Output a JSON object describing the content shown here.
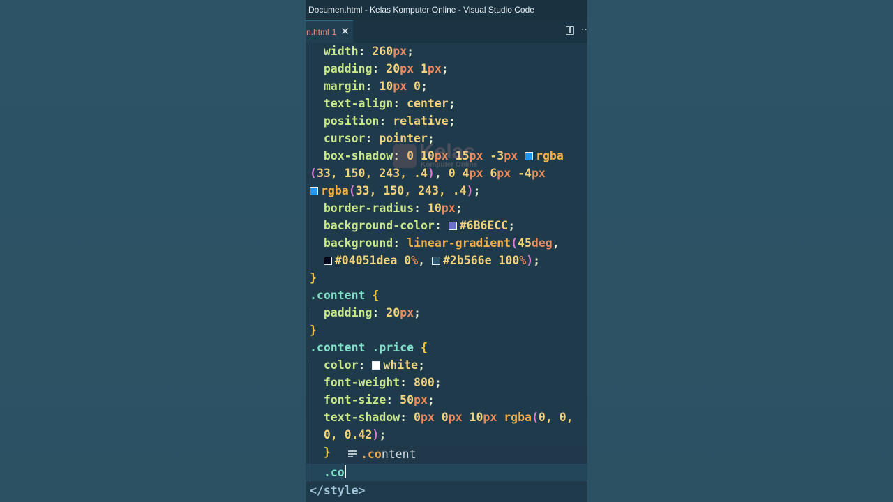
{
  "window": {
    "title": "Documen.html - Kelas Komputer Online - Visual Studio Code"
  },
  "tab": {
    "name": "n.html",
    "problems": "1",
    "close": "✕"
  },
  "toolbar": {
    "more": "···"
  },
  "watermark": {
    "title": "Kelas",
    "subtitle": "Komputer Online"
  },
  "colors": {
    "swatch_rgba": "#2196f3",
    "swatch_6b6ecc": "#6B6ECC",
    "swatch_04051d": "#04051d",
    "swatch_2b566e": "#2b566e",
    "swatch_white": "#ffffff"
  },
  "code": {
    "l1": {
      "prop": "width",
      "num": "260",
      "unit": "px"
    },
    "l2": {
      "prop": "padding",
      "n1": "20",
      "u1": "px",
      "n2": "1",
      "u2": "px"
    },
    "l3": {
      "prop": "margin",
      "n1": "10",
      "u1": "px",
      "n2": "0"
    },
    "l4": {
      "prop": "text-align",
      "value": "center"
    },
    "l5": {
      "prop": "position",
      "value": "relative"
    },
    "l6": {
      "prop": "cursor",
      "value": "pointer"
    },
    "l7": {
      "prop": "box-shadow",
      "v1": "0",
      "v2": "10",
      "u2": "px",
      "v3": "15",
      "u3": "px",
      "v4": "-3",
      "u4": "px",
      "fn": "rgba"
    },
    "l8": {
      "args": "33, 150, 243, .4",
      "v1": "0",
      "v2": "4",
      "u2": "px",
      "v3": "6",
      "u3": "px",
      "v4": "-4",
      "u4": "px"
    },
    "l9": {
      "fn": "rgba",
      "args": "33, 150, 243, .4"
    },
    "l10": {
      "prop": "border-radius",
      "num": "10",
      "unit": "px"
    },
    "l11": {
      "prop": "background-color",
      "value": "#6B6ECC"
    },
    "l12": {
      "prop": "background",
      "fn": "linear-gradient",
      "num": "45",
      "unit": "deg"
    },
    "l13": {
      "c1": "#04051dea",
      "p1": "0",
      "p1u": "%",
      "c2": "#2b566e",
      "p2": "100",
      "p2u": "%"
    },
    "l15": {
      "selector": ".content"
    },
    "l16": {
      "prop": "padding",
      "num": "20",
      "unit": "px"
    },
    "l18": {
      "s1": ".content",
      "s2": ".price"
    },
    "l19": {
      "prop": "color",
      "value": "white"
    },
    "l20": {
      "prop": "font-weight",
      "num": "800"
    },
    "l21": {
      "prop": "font-size",
      "num": "50",
      "unit": "px"
    },
    "l22": {
      "prop": "text-shadow",
      "v1": "0",
      "u1": "px",
      "v2": "0",
      "u2": "px",
      "v3": "10",
      "u3": "px",
      "fn": "rgba",
      "args": "0, 0,"
    },
    "l23": {
      "args": "0, 0.42"
    },
    "l25": {
      "typed": ".co"
    },
    "l26": {
      "tag": "</style>"
    }
  },
  "suggestion": {
    "match": ".co",
    "rest": "ntent"
  }
}
